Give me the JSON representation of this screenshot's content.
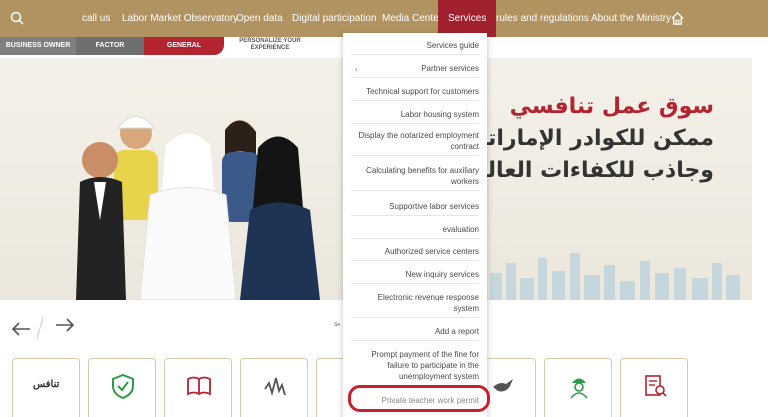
{
  "nav": {
    "items": [
      "call us",
      "Labor Market Observatory",
      "Open data",
      "Digital participation",
      "Media Center",
      "Services",
      "rules and regulations",
      "About the Ministry"
    ],
    "active": "Services"
  },
  "tabs": {
    "business_owner": "BUSINESS OWNER",
    "factor": "FACTOR",
    "general": "GENERAL",
    "personalize": "PERSONALIZE YOUR EXPERIENCE"
  },
  "hero": {
    "line1": "سوق عمل تنافسي",
    "line2": "ممكن للكوادر الإماراتية",
    "line3": "وجاذب للكفاءات العالمية"
  },
  "small_label": "Se",
  "card_logo_text": "تنافس",
  "services_menu": [
    "Services guide",
    "Partner services",
    "Technical support for customers",
    "Labor housing system",
    "Display the notarized employment contract",
    "Calculating benefits for auxiliary workers",
    "Supportive labor services",
    "evaluation",
    "Authorized service centers",
    "New inquiry services",
    "Electronic revenue response system",
    "Add a report",
    "Prompt payment of the fine for failure to participate in the unemployment system",
    "Private teacher work permit"
  ],
  "icons": {
    "search": "search-icon",
    "home": "home-icon"
  },
  "colors": {
    "nav_bg": "#b19361",
    "accent_red": "#b42330",
    "card_border": "#d9c9a8",
    "icon_green": "#2e9a47",
    "icon_red": "#b42330"
  }
}
